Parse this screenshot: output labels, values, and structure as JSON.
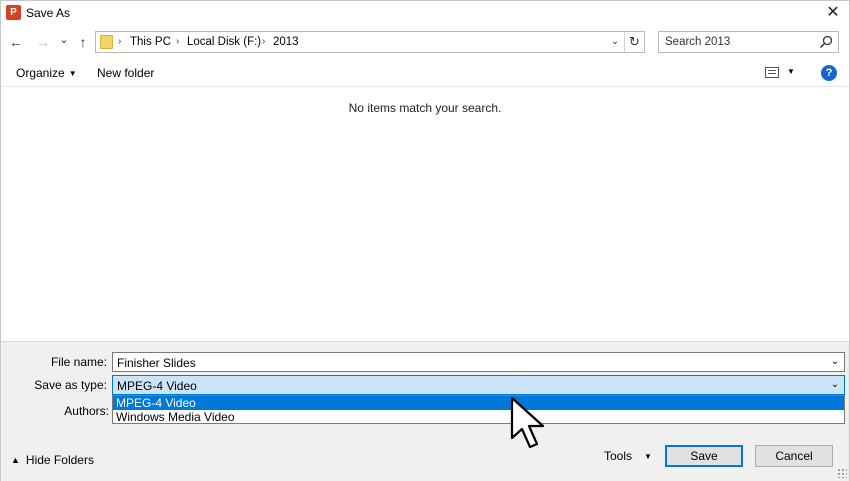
{
  "window": {
    "title": "Save As",
    "app_icon_letter": "P",
    "close_glyph": "✕"
  },
  "navigation": {
    "back_glyph": "←",
    "forward_glyph": "→",
    "recent_glyph": "⌄",
    "up_glyph": "↑"
  },
  "address": {
    "crumbs": [
      "This PC",
      "Local Disk (F:)",
      "2013"
    ],
    "separator": "›",
    "dropdown_glyph": "⌄",
    "refresh_glyph": "↻"
  },
  "search": {
    "placeholder": "Search 2013"
  },
  "toolbar": {
    "organize_label": "Organize",
    "new_folder_label": "New folder",
    "caret_glyph": "▼",
    "help_glyph": "?"
  },
  "content": {
    "empty_message": "No items match your search."
  },
  "form": {
    "file_name_label": "File name:",
    "file_name_value": "Finisher Slides",
    "save_as_type_label": "Save as type:",
    "save_as_type_value": "MPEG-4 Video",
    "authors_label": "Authors:",
    "caret_glyph": "⌄",
    "type_options": [
      "MPEG-4 Video",
      "Windows Media Video"
    ]
  },
  "footer": {
    "hide_folders_label": "Hide Folders",
    "hide_folders_glyph": "▲",
    "tools_label": "Tools",
    "save_label": "Save",
    "cancel_label": "Cancel"
  },
  "colors": {
    "accent": "#0078d7",
    "selection_bg": "#cce4f7",
    "app_icon": "#d04423",
    "panel_bg": "#f0f0f0"
  }
}
